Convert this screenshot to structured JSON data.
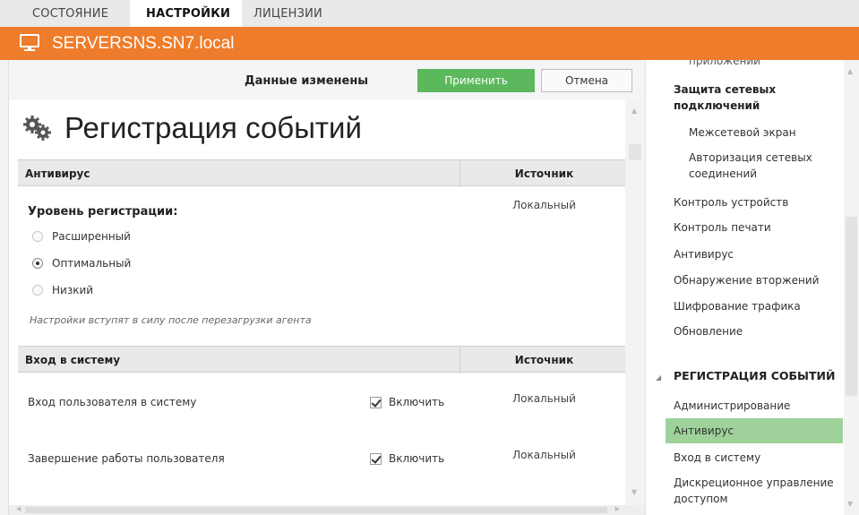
{
  "tabs": [
    {
      "label": "Состояние"
    },
    {
      "label": "Настройки"
    },
    {
      "label": "Лицензии"
    }
  ],
  "server": {
    "name": "SERVERSNS.SN7.local",
    "icon": "monitor-icon",
    "bar_color": "#ef7c2a"
  },
  "toolbar": {
    "status": "Данные изменены",
    "apply_label": "Применить",
    "cancel_label": "Отмена",
    "apply_color": "#5cb85c"
  },
  "page": {
    "title": "Регистрация событий",
    "icon": "gear-icon"
  },
  "antivirus_section": {
    "title": "Антивирус",
    "source_header": "Источник",
    "source_value": "Локальный",
    "level_label": "Уровень регистрации:",
    "options": [
      {
        "label": "Расширенный",
        "checked": false
      },
      {
        "label": "Оптимальный",
        "checked": true
      },
      {
        "label": "Низкий",
        "checked": false
      }
    ],
    "note": "Настройки вступят в силу после перезагрузки агента"
  },
  "login_section": {
    "title": "Вход в систему",
    "source_header": "Источник",
    "rows": [
      {
        "label": "Вход пользователя в систему",
        "check_label": "Включить",
        "checked": true,
        "source": "Локальный"
      },
      {
        "label": "Завершение работы пользователя",
        "check_label": "Включить",
        "checked": true,
        "source": "Локальный"
      }
    ]
  },
  "nav": {
    "partial_top": "приложений",
    "items": [
      {
        "label": "Защита сетевых подключений"
      },
      {
        "label": "Межсетевой экран"
      },
      {
        "label": "Авторизация сетевых соединений"
      },
      {
        "label": "Контроль устройств"
      },
      {
        "label": "Контроль печати"
      },
      {
        "label": "Антивирус"
      },
      {
        "label": "Обнаружение вторжений"
      },
      {
        "label": "Шифрование трафика"
      },
      {
        "label": "Обновление"
      }
    ],
    "section": "РЕГИСТРАЦИЯ СОБЫТИЙ",
    "section_items": [
      {
        "label": "Администрирование"
      },
      {
        "label": "Антивирус",
        "active": true
      },
      {
        "label": "Вход в систему"
      },
      {
        "label": "Дискреционное управление доступом"
      }
    ],
    "active_color": "#9ed29a"
  }
}
